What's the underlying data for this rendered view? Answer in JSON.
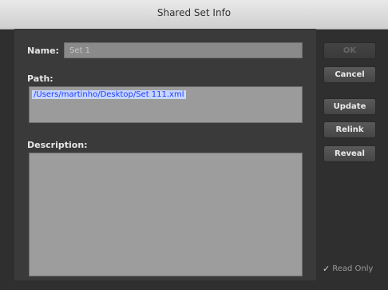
{
  "window": {
    "title": "Shared Set Info"
  },
  "form": {
    "name_label": "Name:",
    "name_value": "Set 1",
    "path_label": "Path:",
    "path_value": "/Users/martinho/Desktop/Set 111.xml",
    "description_label": "Description:",
    "description_value": ""
  },
  "buttons": {
    "ok": "OK",
    "cancel": "Cancel",
    "update": "Update",
    "relink": "Relink",
    "reveal": "Reveal"
  },
  "readonly": {
    "label": "Read Only",
    "checked": true
  }
}
